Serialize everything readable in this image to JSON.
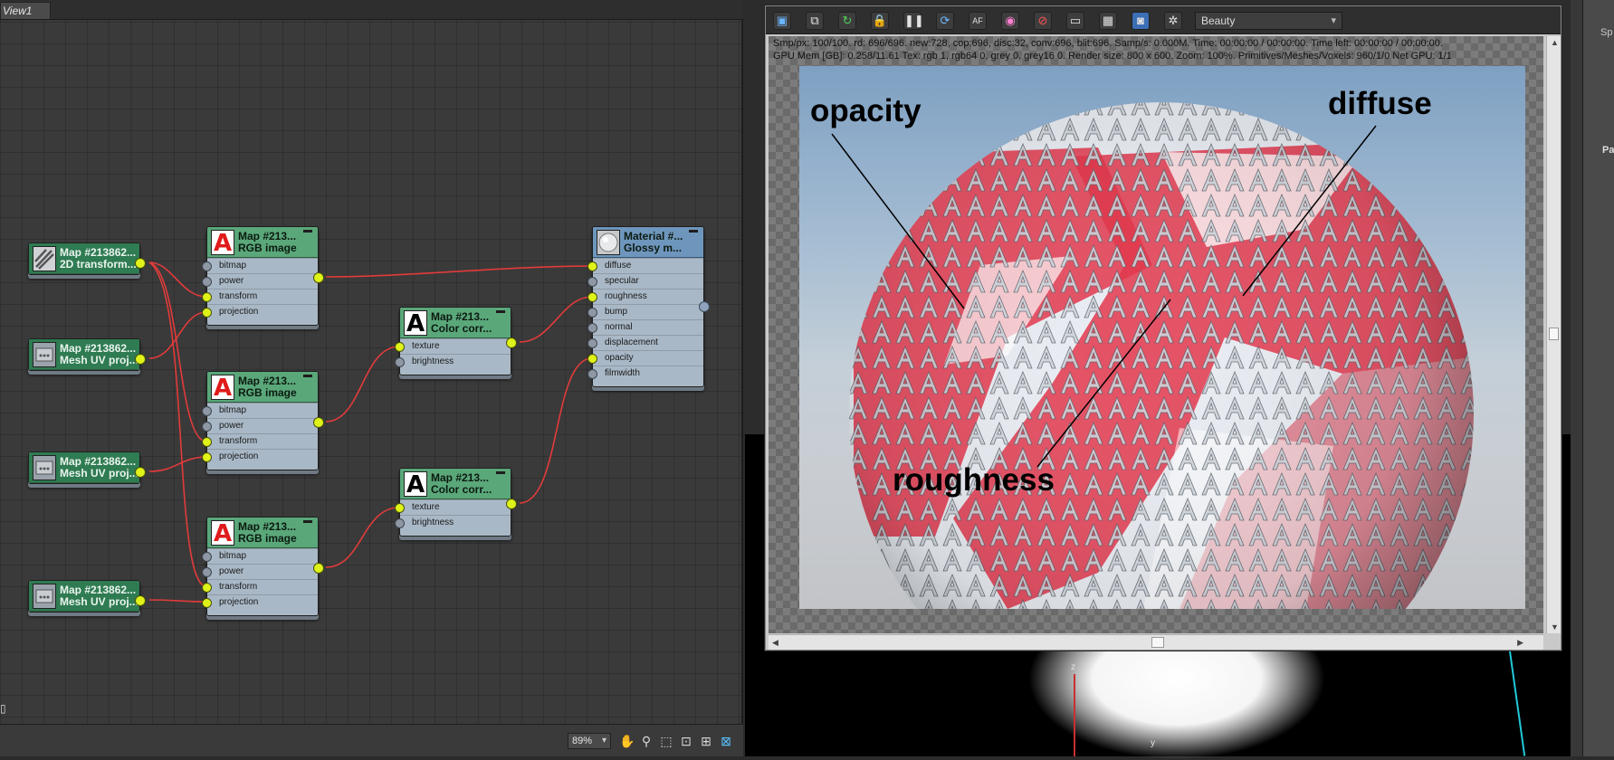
{
  "node_editor": {
    "view_tab": "View1",
    "zoom": "89%",
    "nodes": {
      "transform2d": {
        "title": "Map #213862...",
        "subtitle": "2D transform..."
      },
      "mesh1": {
        "title": "Map #213862...",
        "subtitle": "Mesh UV proj..."
      },
      "mesh2": {
        "title": "Map #213862...",
        "subtitle": "Mesh UV proj..."
      },
      "mesh3": {
        "title": "Map #213862...",
        "subtitle": "Mesh UV proj..."
      },
      "rgb1": {
        "title": "Map #213...",
        "subtitle": "RGB image",
        "ports": [
          "bitmap",
          "power",
          "transform",
          "projection"
        ]
      },
      "rgb2": {
        "title": "Map #213...",
        "subtitle": "RGB image",
        "ports": [
          "bitmap",
          "power",
          "transform",
          "projection"
        ]
      },
      "rgb3": {
        "title": "Map #213...",
        "subtitle": "RGB image",
        "ports": [
          "bitmap",
          "power",
          "transform",
          "projection"
        ]
      },
      "cc1": {
        "title": "Map #213...",
        "subtitle": "Color corr...",
        "ports": [
          "texture",
          "brightness"
        ]
      },
      "cc2": {
        "title": "Map #213...",
        "subtitle": "Color corr...",
        "ports": [
          "texture",
          "brightness"
        ]
      },
      "material": {
        "title": "Material #...",
        "subtitle": "Glossy m...",
        "ports": [
          "diffuse",
          "specular",
          "roughness",
          "bump",
          "normal",
          "displacement",
          "opacity",
          "filmwidth"
        ]
      }
    },
    "icons": {
      "rgb": "A",
      "cc": "A"
    },
    "colors": {
      "wire": "#e23b3b",
      "port_active": "#dff21a",
      "node_map": "#5aa77a",
      "node_material": "#6e96bd"
    }
  },
  "render_window": {
    "pass": "Beauty",
    "stats_line1": "Smp/px: 100/100.   rd: 696/696.   new:728, cop:696, disc:32, conv:696, blit:696.   Samp/s: 0.000M.   Time: 00:00:00 / 00:00:00.   Time left: 00:00:00 / 00:00:00.",
    "stats_line2": "GPU Mem [GB]: 0.258/11.61   Tex: rgb 1, rgb64 0, grey 0, grey16 0.   Render size: 800 x 600.   Zoom: 100%.   Primitives/Meshes/Voxels: 960/1/0   Net GPU: 1/1",
    "callouts": {
      "opacity": "opacity",
      "diffuse": "diffuse",
      "roughness": "roughness"
    },
    "colors": {
      "sphere_red": "#e3354a",
      "sphere_white": "#e9edf3"
    }
  },
  "viewport": {
    "axis_z": "z",
    "axis_y": "y",
    "side_label": "Pa",
    "side_sp": "Sp"
  }
}
